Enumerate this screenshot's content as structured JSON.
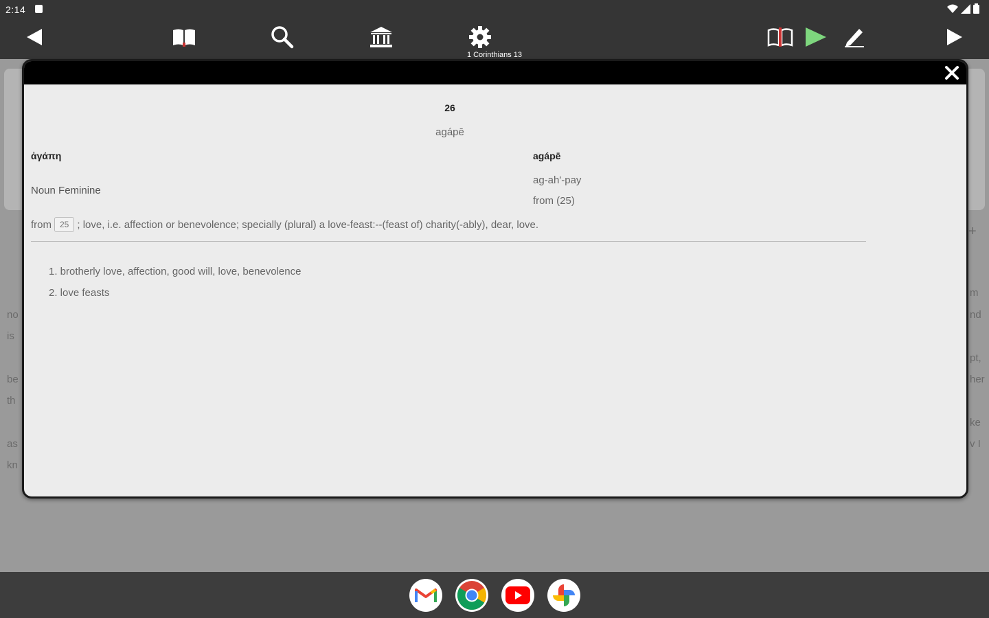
{
  "status_bar": {
    "time": "2:14",
    "icons": [
      "notification-icon",
      "wifi-icon",
      "cellular-icon",
      "battery-icon"
    ]
  },
  "toolbar": {
    "subtitle": "1 Corinthians 13",
    "icons": [
      "back-arrow-icon",
      "bible-book-icon",
      "search-icon",
      "library-icon",
      "settings-gear-icon",
      "parallel-books-icon",
      "play-icon",
      "pen-icon",
      "forward-arrow-icon"
    ],
    "play_color": "#7ed67e"
  },
  "background_text": {
    "left": [
      "no",
      "is",
      "be",
      "th",
      "as",
      "kn"
    ],
    "right": [
      "+",
      "m",
      "nd",
      "pt,",
      "her",
      "ke",
      "v I"
    ]
  },
  "dialog": {
    "entry_number": "26",
    "transliteration_heading": "agápē",
    "greek_word": "ἀγάπη",
    "part_of_speech": "Noun Feminine",
    "transliteration": "agápē",
    "pronunciation": "ag-ah'-pay",
    "derivation": "from (25)",
    "definition": {
      "prefix": "from",
      "ref": "25",
      "text": "; love, i.e. affection or benevolence; specially (plural) a love-feast:--(feast of) charity(-ably), dear, love."
    },
    "outline": [
      "1. brotherly love, affection, good will, love, benevolence",
      "2. love feasts"
    ]
  },
  "dock": {
    "apps": [
      "gmail-icon",
      "chrome-icon",
      "youtube-icon",
      "photos-icon"
    ]
  }
}
